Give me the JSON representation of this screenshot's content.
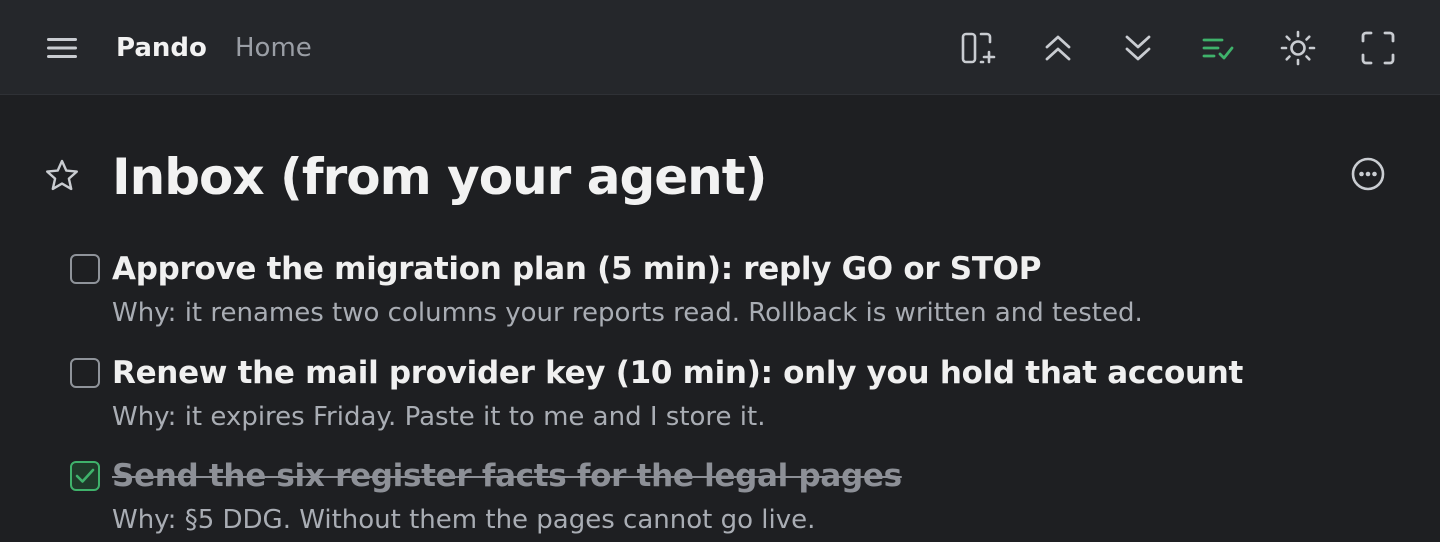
{
  "header": {
    "brand": "Pando",
    "breadcrumb": "Home",
    "icons": [
      "menu-icon",
      "add-panel-icon",
      "collapse-all-icon",
      "expand-all-icon",
      "checklist-icon",
      "sun-icon",
      "fullscreen-icon"
    ],
    "accent": "#3fb26b"
  },
  "page": {
    "title": "Inbox (from your agent)",
    "star_icon": "star-outline-icon",
    "more_icon": "more-options-icon"
  },
  "tasks": [
    {
      "title": "Approve the migration plan (5 min): reply GO or STOP",
      "note": "Why: it renames two columns your reports read. Rollback is written and tested.",
      "done": false
    },
    {
      "title": "Renew the mail provider key (10 min): only you hold that account",
      "note": "Why: it expires Friday. Paste it to me and I store it.",
      "done": false
    },
    {
      "title": "Send the six register facts for the legal pages",
      "note": "Why: §5 DDG. Without them the pages cannot go live.",
      "done": true
    }
  ]
}
